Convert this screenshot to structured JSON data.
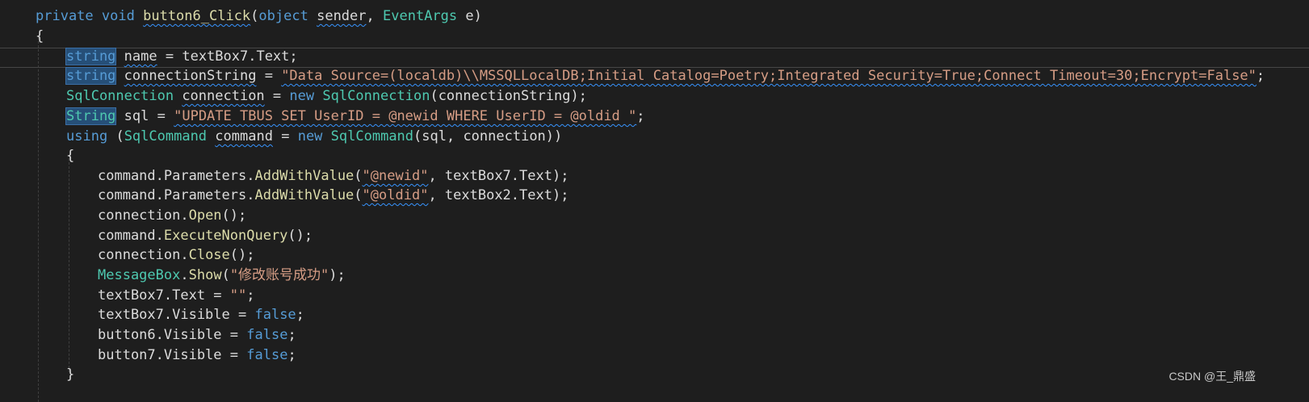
{
  "colors": {
    "background": "#1e1e1e",
    "keyword": "#569cd6",
    "type": "#4ec9b0",
    "method": "#dcdcaa",
    "string": "#d69d85",
    "identifier": "#dcdcdc",
    "selection": "#264f78",
    "squiggle": "#3794ff"
  },
  "code": {
    "l1": {
      "kw1": "private",
      "kw2": "void",
      "name": "button6_Click",
      "p1": "(",
      "t1": "object",
      "a1": "sender",
      "p2": ",",
      "t2": "EventArgs",
      "a2": "e",
      "p3": ")"
    },
    "l2": {
      "brace": "{"
    },
    "l3": {
      "kw": "string",
      "name": "name",
      "rest": "= textBox7.Text;"
    },
    "l4": {
      "kw": "string",
      "name": "connectionString",
      "eq": "=",
      "str": "\"Data Source=(localdb)\\\\MSSQLLocalDB;Initial Catalog=Poetry;Integrated Security=True;Connect Timeout=30;Encrypt=False\"",
      "end": ";"
    },
    "l5": {
      "type": "SqlConnection",
      "name": "connection",
      "eq": "=",
      "kw": "new",
      "type2": "SqlConnection",
      "args": "(connectionString);"
    },
    "l6": {
      "type": "String",
      "rest": "sql =",
      "str": "\"UPDATE TBUS SET UserID = @newid WHERE UserID = @oldid \"",
      "end": ";"
    },
    "l7": {
      "kw": "using",
      "p1": "(",
      "type": "SqlCommand",
      "name": "command",
      "eq": "=",
      "kw2": "new",
      "type2": "SqlCommand",
      "args": "(sql, connection))"
    },
    "l8": {
      "brace": "{"
    },
    "l9": {
      "obj": "command.Parameters.",
      "fn": "AddWithValue",
      "p1": "(",
      "str": "\"@newid\"",
      "rest": ", textBox7.Text);"
    },
    "l10": {
      "obj": "command.Parameters.",
      "fn": "AddWithValue",
      "p1": "(",
      "str": "\"@oldid\"",
      "rest": ", textBox2.Text);"
    },
    "l11": {
      "obj": "connection.",
      "fn": "Open",
      "rest": "();"
    },
    "l12": {
      "obj": "command.",
      "fn": "ExecuteNonQuery",
      "rest": "();"
    },
    "l13": {
      "obj": "connection.",
      "fn": "Close",
      "rest": "();"
    },
    "l14": {
      "type": "MessageBox",
      "dot": ".",
      "fn": "Show",
      "p1": "(",
      "str": "\"修改账号成功\"",
      "rest": ");"
    },
    "l15": {
      "obj": "textBox7.Text =",
      "str": "\"\"",
      "rest": ";"
    },
    "l16": {
      "obj": "textBox7.Visible =",
      "kw": "false",
      "rest": ";"
    },
    "l17": {
      "obj": "button6.Visible =",
      "kw": "false",
      "rest": ";"
    },
    "l18": {
      "obj": "button7.Visible =",
      "kw": "false",
      "rest": ";"
    },
    "l19": {
      "brace": "}"
    }
  },
  "watermark": "CSDN @王_鼎盛"
}
